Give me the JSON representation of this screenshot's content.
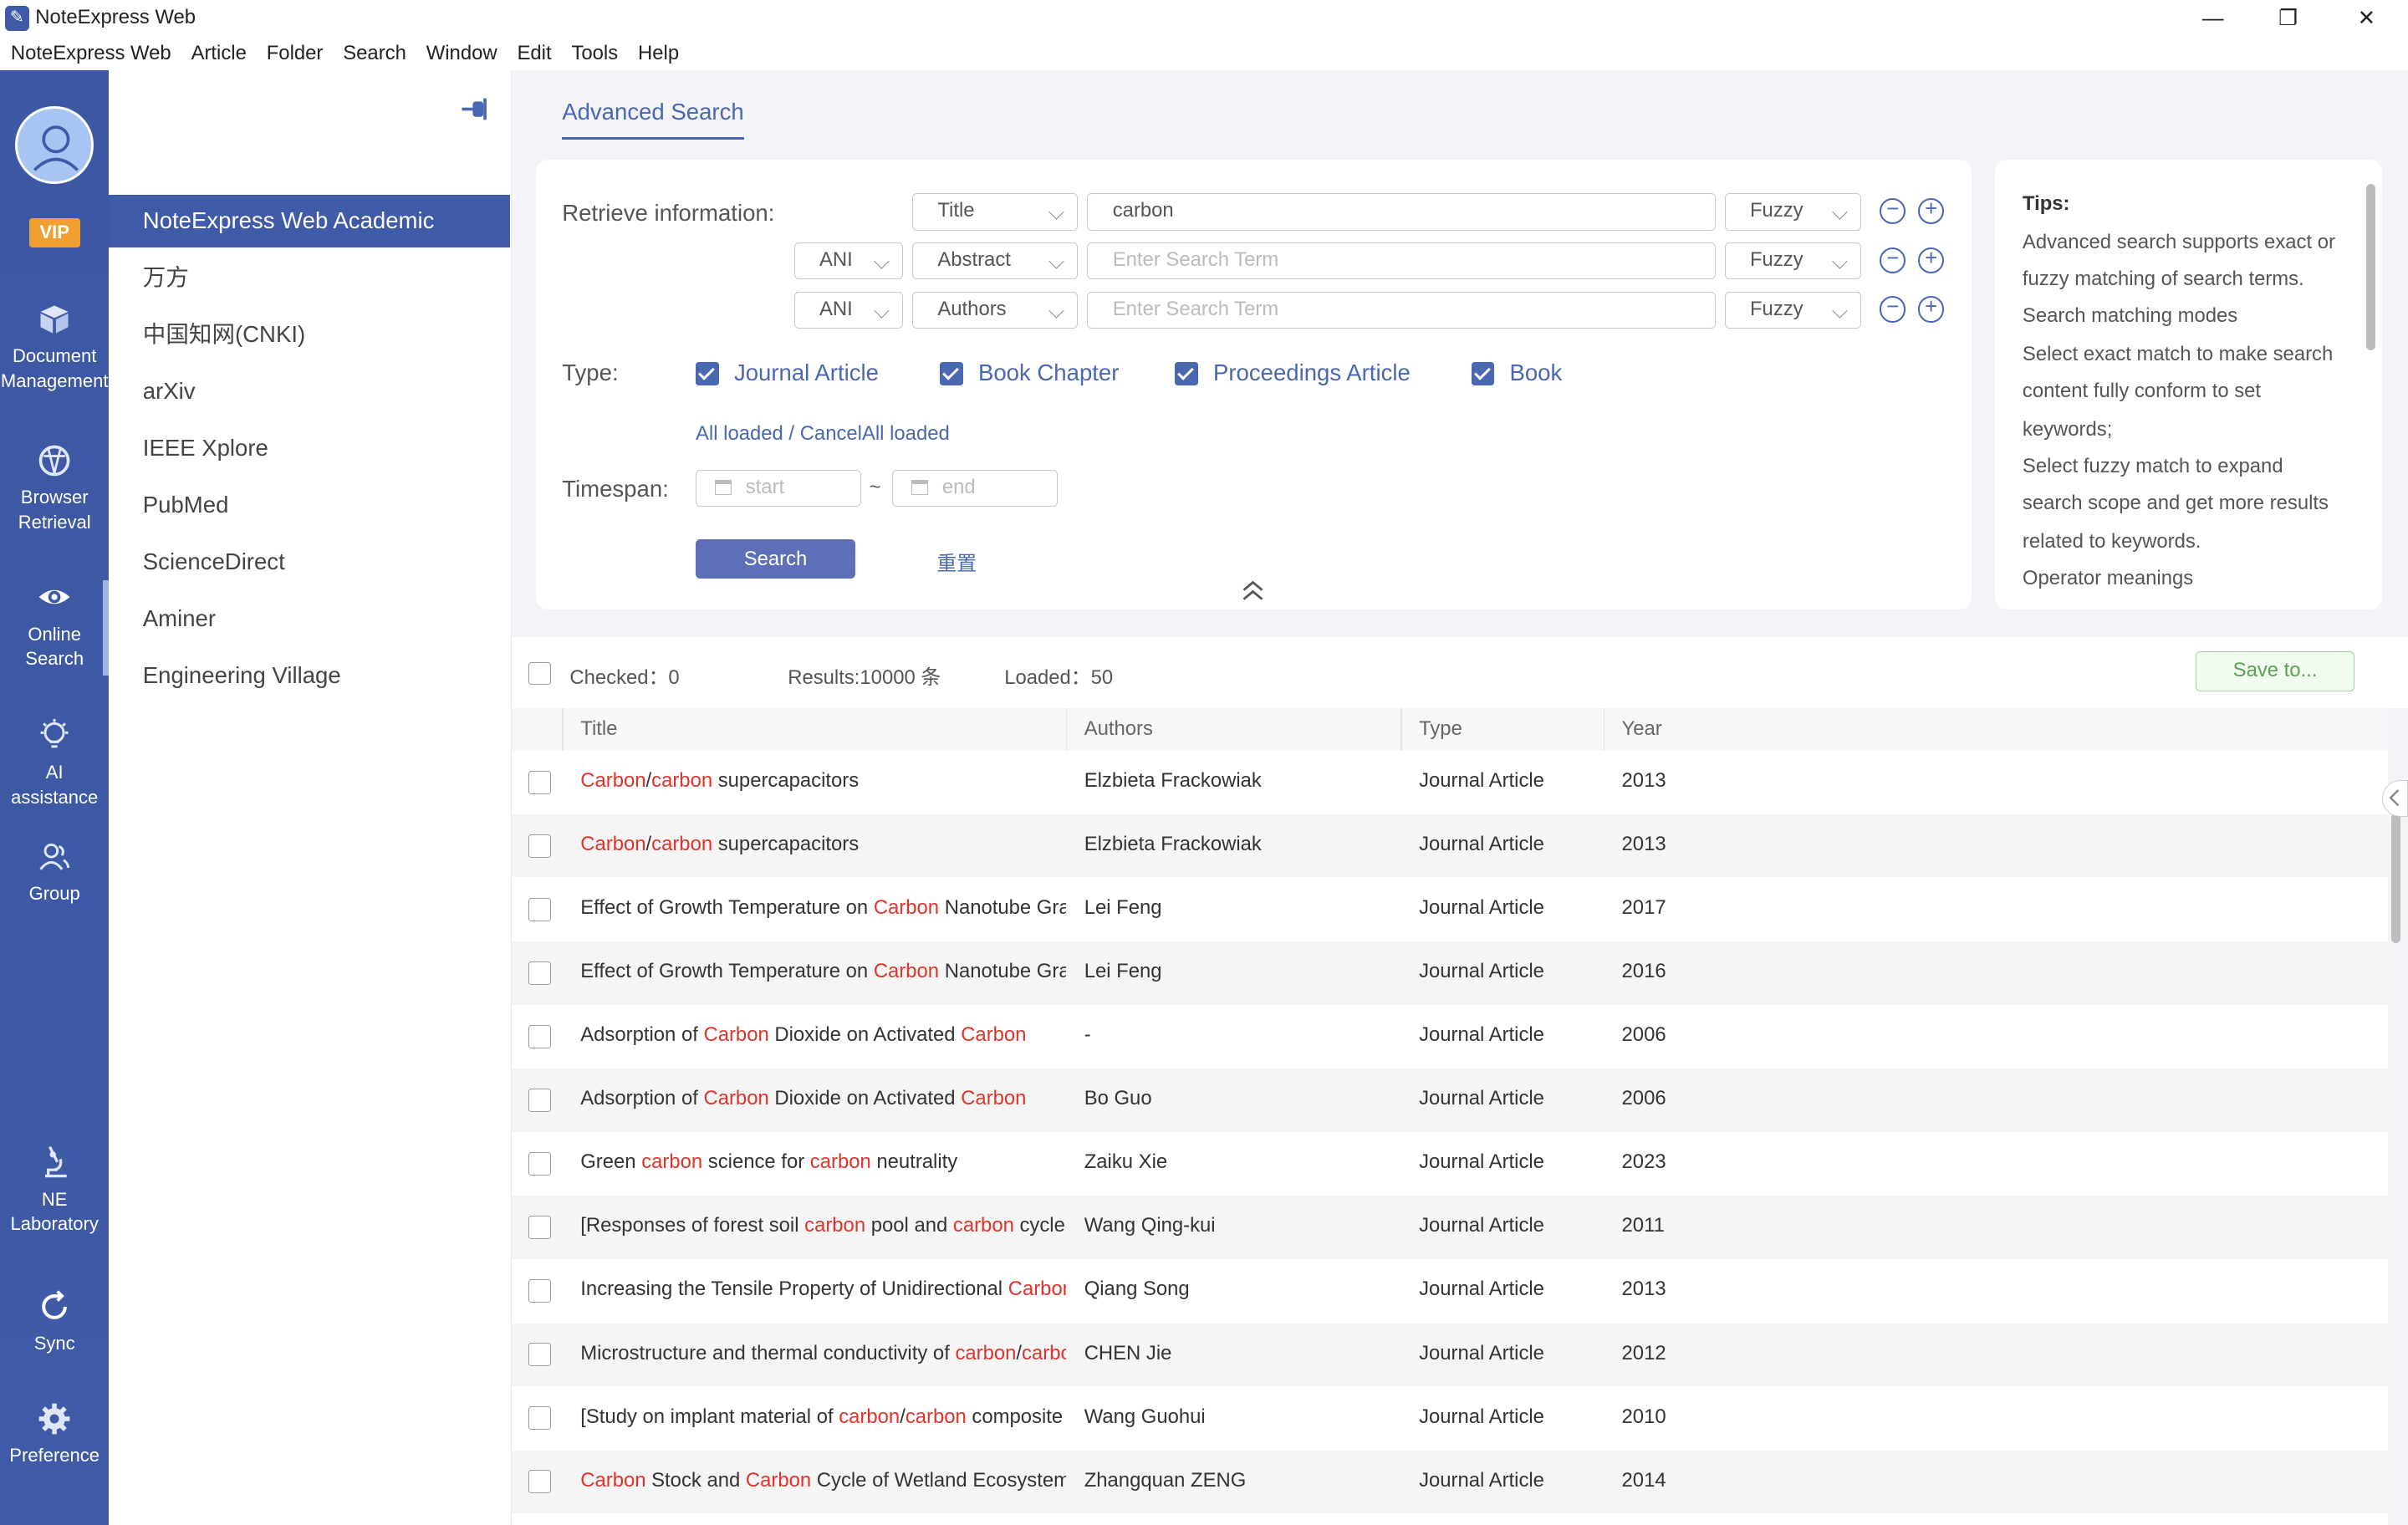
{
  "window": {
    "title": "NoteExpress Web",
    "minimize": "—",
    "maximize": "❐",
    "close": "✕"
  },
  "menu": [
    "NoteExpress Web",
    "Article",
    "Folder",
    "Search",
    "Window",
    "Edit",
    "Tools",
    "Help"
  ],
  "nav": {
    "vip": "VIP",
    "items": [
      {
        "label1": "Document",
        "label2": "Management"
      },
      {
        "label1": "Browser",
        "label2": "Retrieval"
      },
      {
        "label1": "Online",
        "label2": "Search"
      },
      {
        "label1": "AI assistance",
        "label2": ""
      },
      {
        "label1": "Group",
        "label2": ""
      },
      {
        "label1": "NE",
        "label2": "Laboratory"
      },
      {
        "label1": "Sync",
        "label2": ""
      },
      {
        "label1": "Preference",
        "label2": ""
      }
    ]
  },
  "sources": [
    "NoteExpress Web Academic Search",
    "万方",
    "中国知网(CNKI)",
    "arXiv",
    "IEEE Xplore",
    "PubMed",
    "ScienceDirect",
    "Aminer",
    "Engineering Village"
  ],
  "tab": "Advanced Search",
  "search": {
    "retrieve_label": "Retrieve information:",
    "rows": [
      {
        "op": "",
        "field": "Title",
        "value": "carbon",
        "placeholder": "",
        "match": "Fuzzy"
      },
      {
        "op": "ANI",
        "field": "Abstract",
        "value": "",
        "placeholder": "Enter Search Term",
        "match": "Fuzzy"
      },
      {
        "op": "ANI",
        "field": "Authors",
        "value": "",
        "placeholder": "Enter Search Term",
        "match": "Fuzzy"
      }
    ],
    "minus": "−",
    "plus": "+",
    "type_label": "Type:",
    "types": [
      {
        "label": "Journal Article",
        "checked": true
      },
      {
        "label": "Book Chapter",
        "checked": true
      },
      {
        "label": "Proceedings Article",
        "checked": true
      },
      {
        "label": "Book",
        "checked": true
      }
    ],
    "all_loaded": "All loaded / CancelAll loaded",
    "timespan_label": "Timespan:",
    "start_placeholder": "start",
    "tilde": "~",
    "end_placeholder": "end",
    "search_button": "Search",
    "reset_button": "重置"
  },
  "tips": {
    "title": "Tips:",
    "lines": [
      "Advanced search supports exact or",
      "fuzzy matching of search terms.",
      "Search matching modes",
      "Select exact match to make search",
      "content fully conform to set",
      "keywords;",
      "Select fuzzy match to expand",
      "search scope and get more results",
      "related to keywords.",
      "Operator meanings"
    ]
  },
  "results": {
    "checked": "Checked：0",
    "count": "Results:10000 条",
    "loaded": "Loaded：50",
    "save_button": "Save to..."
  },
  "table": {
    "headers": [
      "Title",
      "Authors",
      "Type",
      "Year"
    ],
    "rows": [
      {
        "title": [
          [
            "Carbon",
            true
          ],
          [
            "/",
            false
          ],
          [
            "carbon",
            true
          ],
          [
            " supercapacitors",
            false
          ]
        ],
        "authors": "Elzbieta Frackowiak",
        "type": "Journal Article",
        "year": "2013"
      },
      {
        "title": [
          [
            "Carbon",
            true
          ],
          [
            "/",
            false
          ],
          [
            "carbon",
            true
          ],
          [
            " supercapacitors",
            false
          ]
        ],
        "authors": "Elzbieta Frackowiak",
        "type": "Journal Article",
        "year": "2013"
      },
      {
        "title": [
          [
            "Effect of Growth Temperature on ",
            false
          ],
          [
            "Carbon",
            true
          ],
          [
            " Nanotube Gra",
            false
          ]
        ],
        "authors": "Lei Feng",
        "type": "Journal Article",
        "year": "2017"
      },
      {
        "title": [
          [
            "Effect of Growth Temperature on ",
            false
          ],
          [
            "Carbon",
            true
          ],
          [
            " Nanotube Gra",
            false
          ]
        ],
        "authors": "Lei Feng",
        "type": "Journal Article",
        "year": "2016"
      },
      {
        "title": [
          [
            "Adsorption of ",
            false
          ],
          [
            "Carbon",
            true
          ],
          [
            " Dioxide on Activated ",
            false
          ],
          [
            "Carbon",
            true
          ]
        ],
        "authors": "-",
        "type": "Journal Article",
        "year": "2006"
      },
      {
        "title": [
          [
            "Adsorption of ",
            false
          ],
          [
            "Carbon",
            true
          ],
          [
            " Dioxide on Activated ",
            false
          ],
          [
            "Carbon",
            true
          ]
        ],
        "authors": "Bo Guo",
        "type": "Journal Article",
        "year": "2006"
      },
      {
        "title": [
          [
            "Green ",
            false
          ],
          [
            "carbon",
            true
          ],
          [
            " science for ",
            false
          ],
          [
            "carbon",
            true
          ],
          [
            " neutrality",
            false
          ]
        ],
        "authors": "Zaiku Xie",
        "type": "Journal Article",
        "year": "2023"
      },
      {
        "title": [
          [
            "[Responses of forest soil ",
            false
          ],
          [
            "carbon",
            true
          ],
          [
            " pool and ",
            false
          ],
          [
            "carbon",
            true
          ],
          [
            " cycle",
            false
          ]
        ],
        "authors": "Wang Qing-kui",
        "type": "Journal Article",
        "year": "2011"
      },
      {
        "title": [
          [
            "Increasing the Tensile Property of Unidirectional ",
            false
          ],
          [
            "Carbon",
            true
          ]
        ],
        "authors": "Qiang Song",
        "type": "Journal Article",
        "year": "2013"
      },
      {
        "title": [
          [
            "Microstructure and thermal conductivity of ",
            false
          ],
          [
            "carbon",
            true
          ],
          [
            "/",
            false
          ],
          [
            "carbon",
            true
          ]
        ],
        "authors": "CHEN Jie",
        "type": "Journal Article",
        "year": "2012"
      },
      {
        "title": [
          [
            "[Study on implant material of ",
            false
          ],
          [
            "carbon",
            true
          ],
          [
            "/",
            false
          ],
          [
            "carbon",
            true
          ],
          [
            " composite",
            false
          ]
        ],
        "authors": "Wang Guohui",
        "type": "Journal Article",
        "year": "2010"
      },
      {
        "title": [
          [
            "Carbon",
            true
          ],
          [
            " Stock and ",
            false
          ],
          [
            "Carbon",
            true
          ],
          [
            " Cycle of Wetland Ecosystem",
            false
          ]
        ],
        "authors": "Zhangquan ZENG",
        "type": "Journal Article",
        "year": "2014"
      }
    ]
  },
  "colors": {
    "nav_bg": "#3f5aa6",
    "accent": "#4a67b1",
    "highlight": "#e0342a",
    "vip": "#f0a030",
    "save": "#5aa152"
  }
}
